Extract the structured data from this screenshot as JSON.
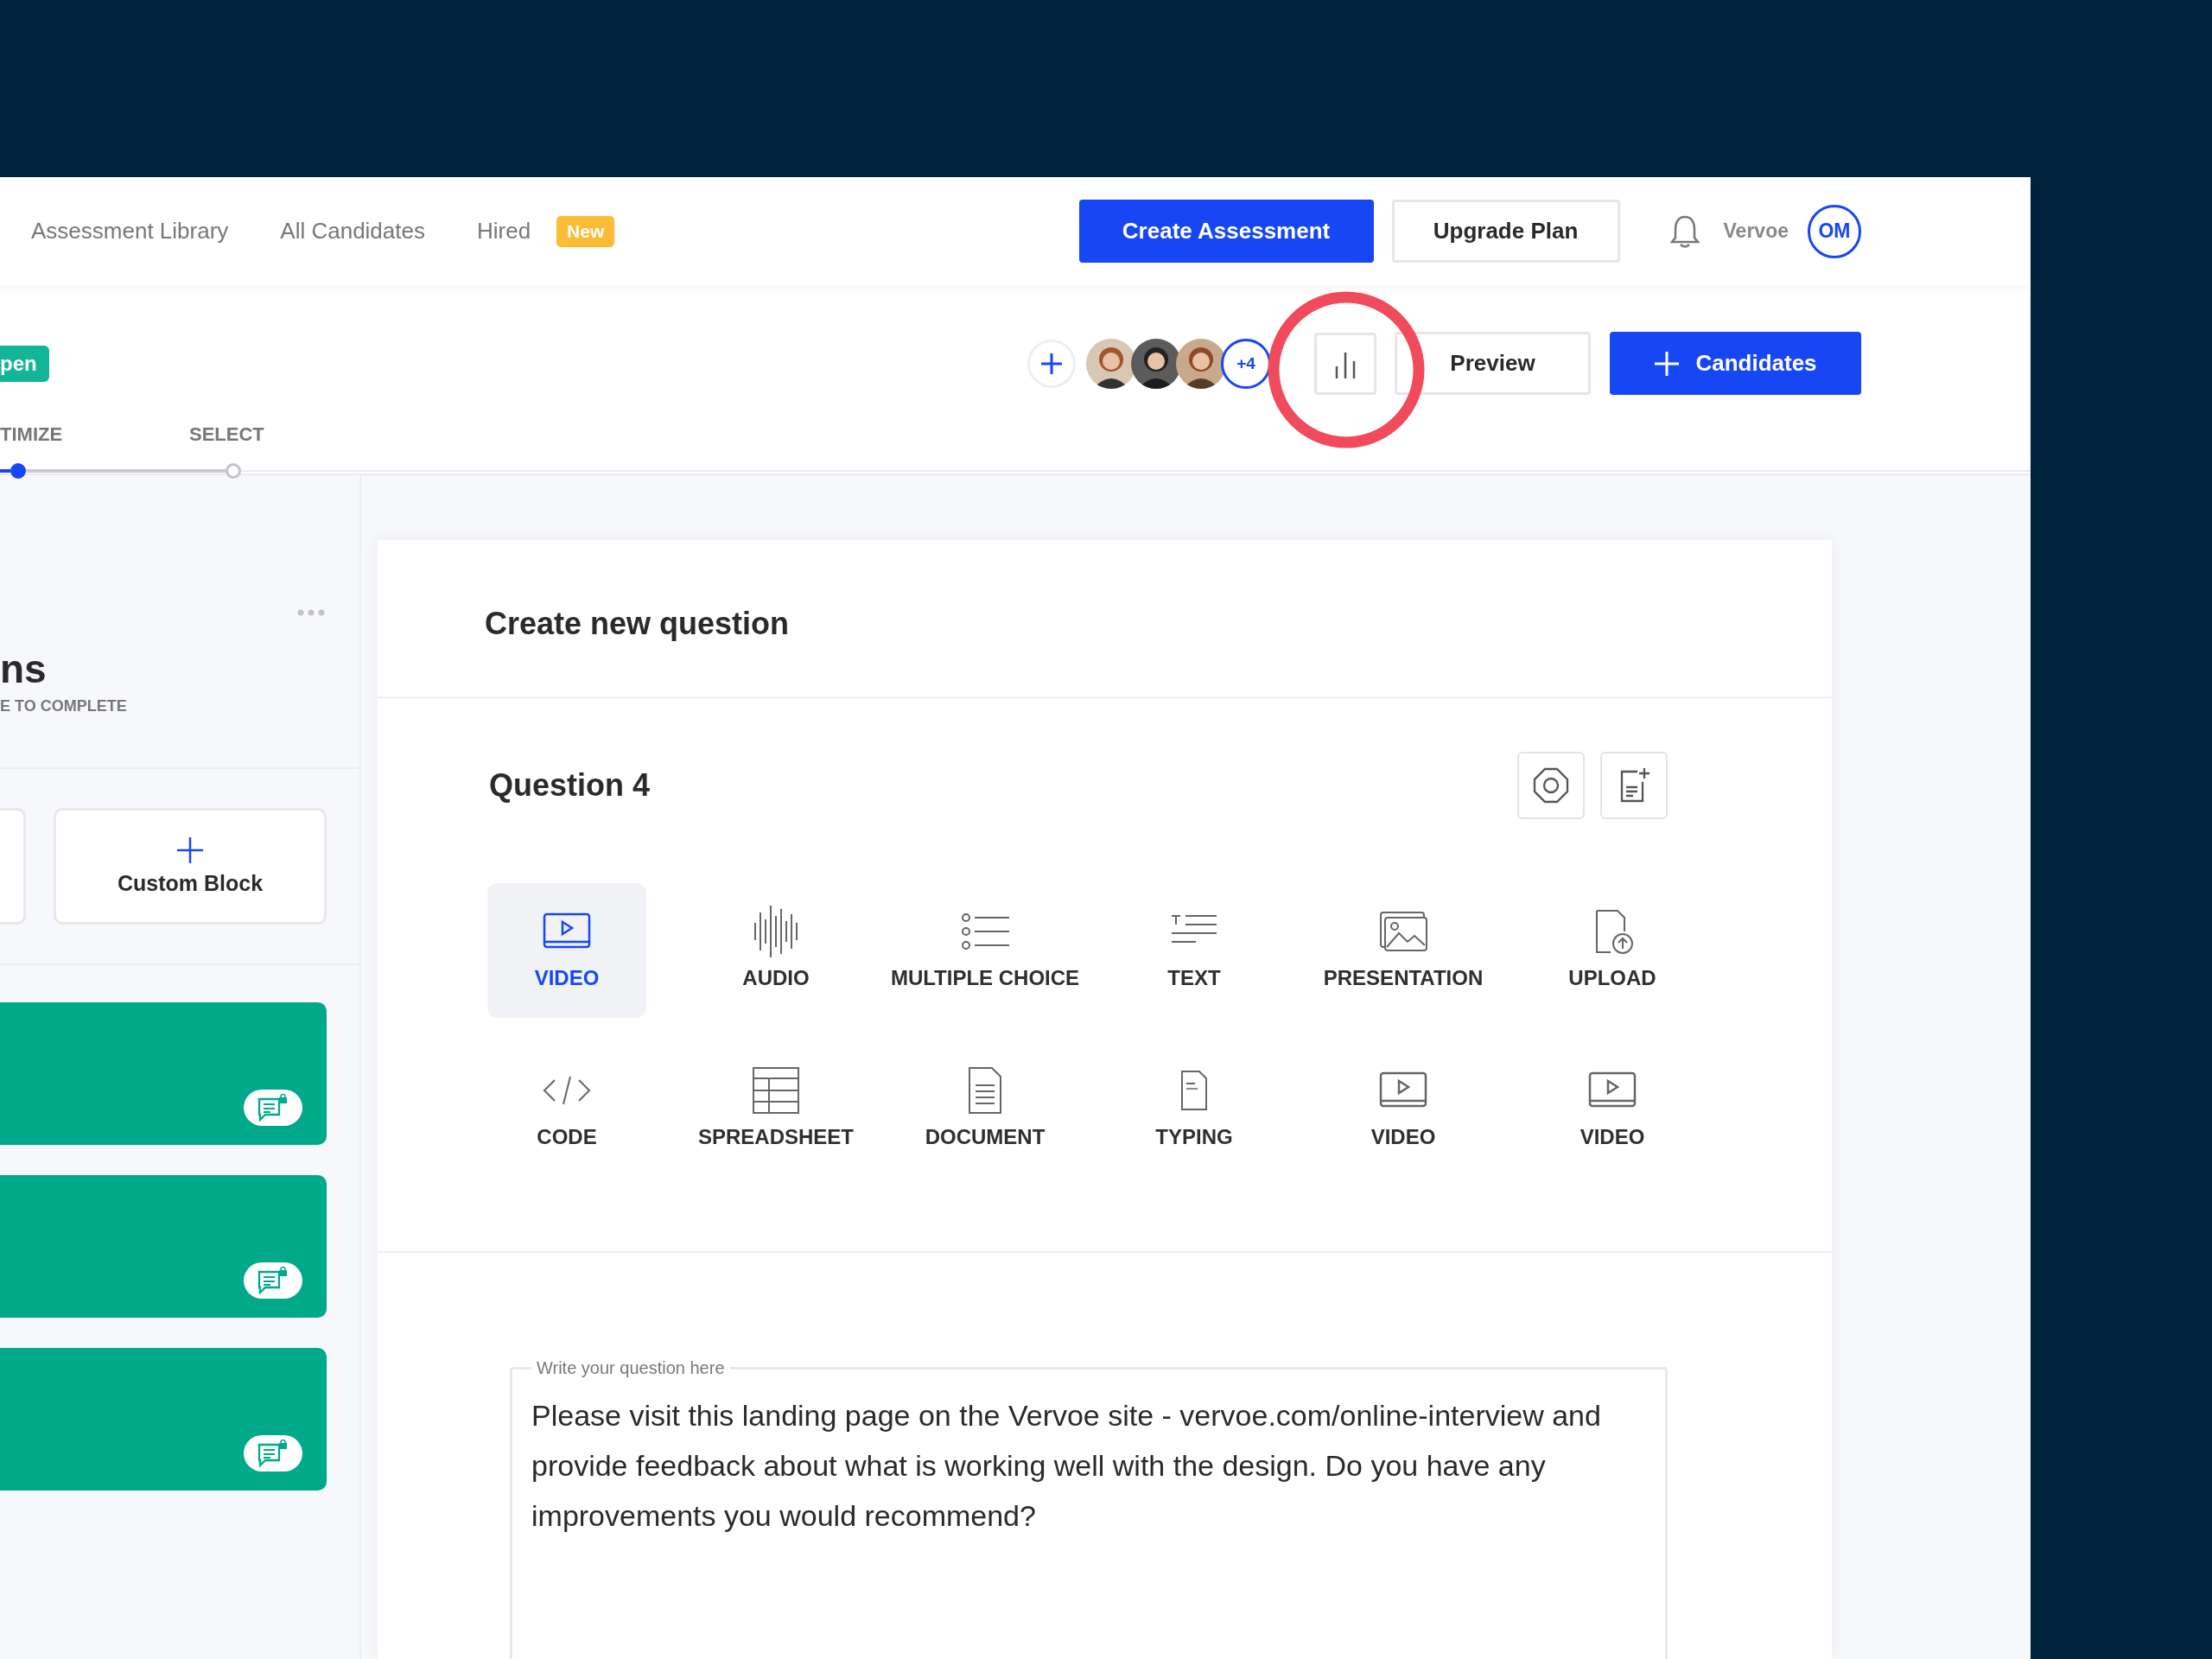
{
  "nav": {
    "links": [
      {
        "label": "Assessment Library"
      },
      {
        "label": "All Candidates"
      },
      {
        "label": "Hired",
        "badge": "New"
      }
    ],
    "create_button": "Create Assessment",
    "upgrade_button": "Upgrade Plan",
    "account_name": "Vervoe",
    "user_initials": "OM"
  },
  "header": {
    "status_badge": "pen",
    "more_collaborators": "+4",
    "preview_button": "Preview",
    "candidates_button": "Candidates",
    "steps": [
      {
        "label": "TIMIZE",
        "selected": true
      },
      {
        "label": "SELECT",
        "selected": false
      }
    ]
  },
  "sidebar": {
    "title": "ns",
    "subtitle": "E TO COMPLETE",
    "add_blocks": [
      {
        "kind": "blank"
      },
      {
        "kind": "custom",
        "label": "Custom Block"
      }
    ],
    "question_blocks": [
      {
        "kind": "locked-chat"
      },
      {
        "kind": "locked-chat"
      },
      {
        "kind": "locked-chat"
      }
    ]
  },
  "editor": {
    "title": "Create new question",
    "question_title": "Question 4",
    "question_types": [
      {
        "kind": "video",
        "label": "VIDEO",
        "selected": true
      },
      {
        "kind": "audio",
        "label": "AUDIO",
        "selected": false
      },
      {
        "kind": "multiple_choice",
        "label": "MULTIPLE CHOICE",
        "selected": false
      },
      {
        "kind": "text",
        "label": "TEXT",
        "selected": false
      },
      {
        "kind": "presentation",
        "label": "PRESENTATION",
        "selected": false
      },
      {
        "kind": "upload",
        "label": "UPLOAD",
        "selected": false
      },
      {
        "kind": "code",
        "label": "CODE",
        "selected": false
      },
      {
        "kind": "spreadsheet",
        "label": "SPREADSHEET",
        "selected": false
      },
      {
        "kind": "document",
        "label": "DOCUMENT",
        "selected": false
      },
      {
        "kind": "typing",
        "label": "TYPING",
        "selected": false
      },
      {
        "kind": "video",
        "label": "VIDEO",
        "selected": false
      },
      {
        "kind": "video",
        "label": "VIDEO",
        "selected": false
      }
    ],
    "question_field": {
      "label": "Write your question here",
      "value": "Please visit this landing page on the Vervoe site - vervoe.com/online-interview and provide feedback about what is working well with the design. Do you have any improvements you would recommend?"
    }
  }
}
